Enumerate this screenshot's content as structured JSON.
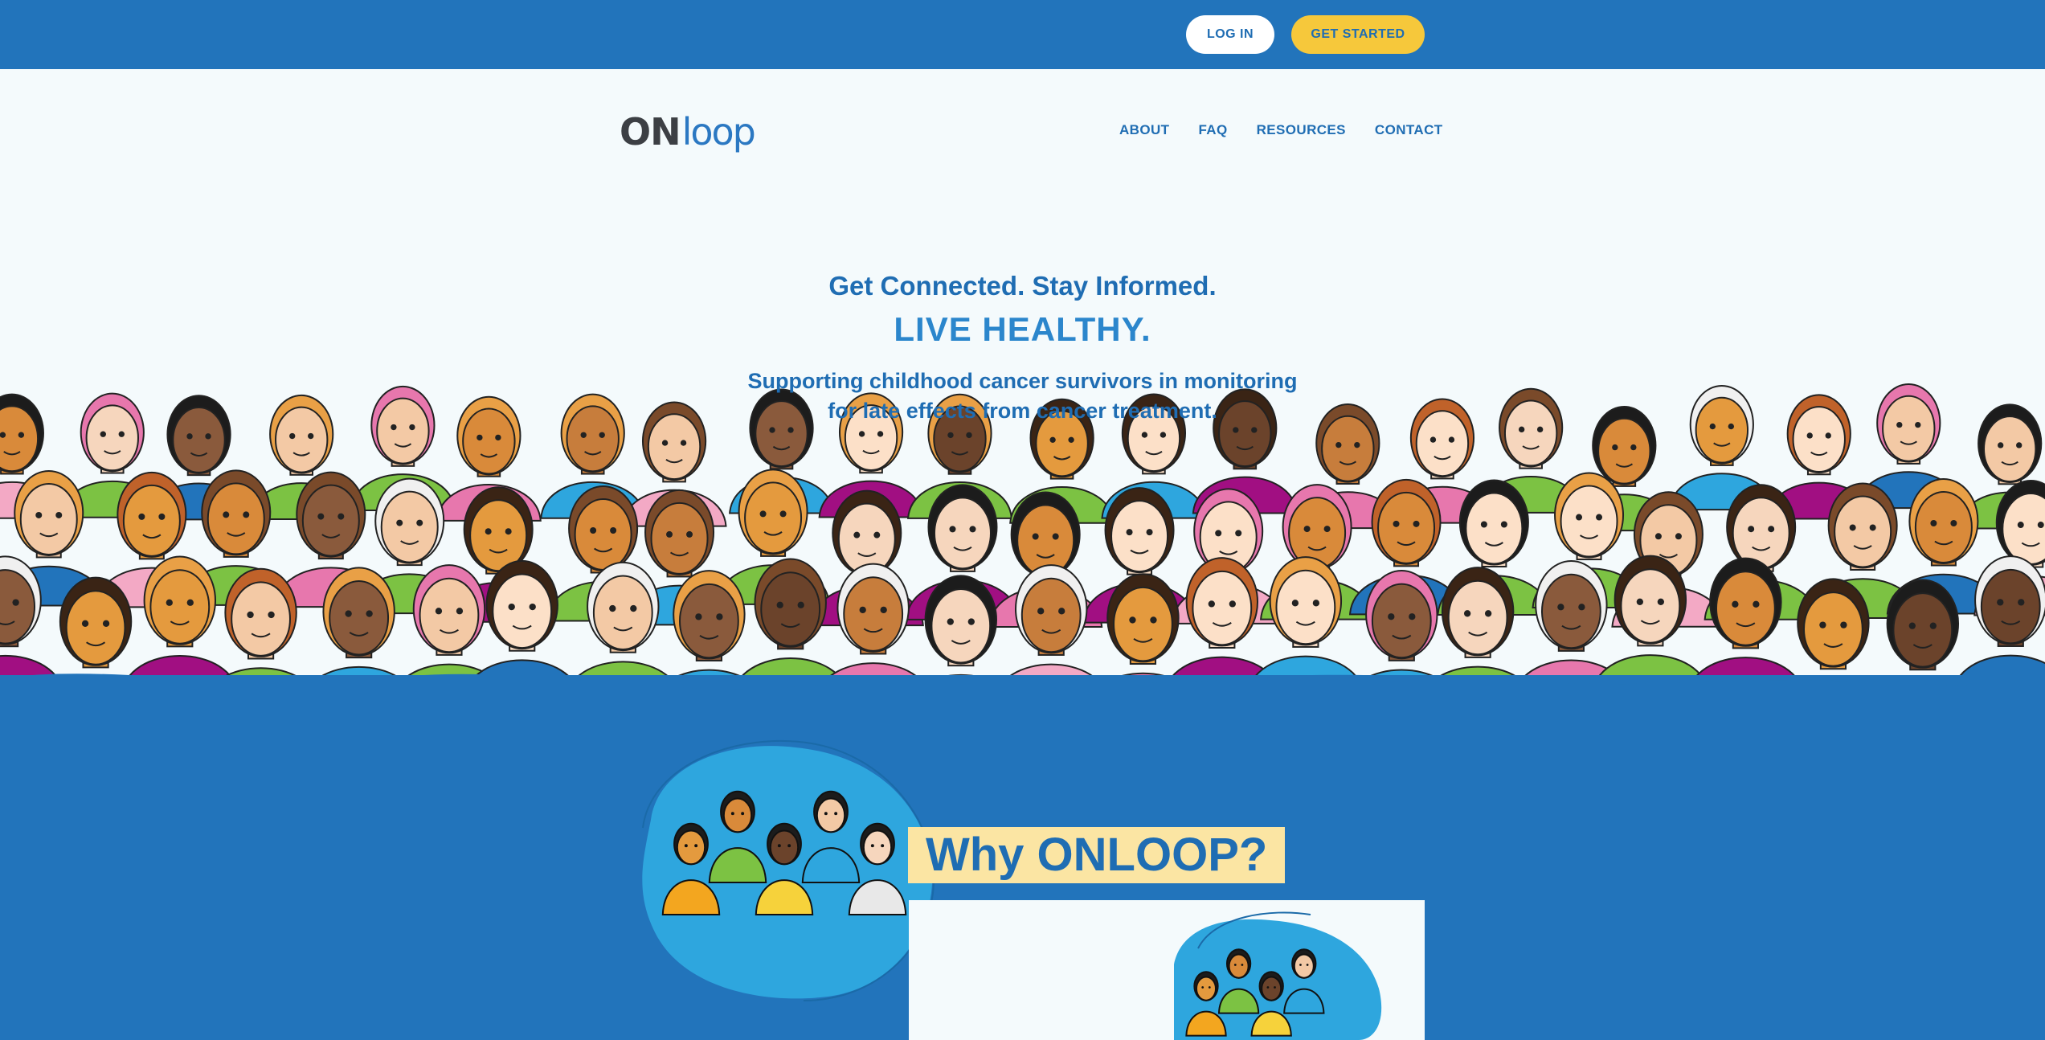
{
  "topbar": {
    "login_label": "LOG IN",
    "get_started_label": "GET STARTED"
  },
  "header": {
    "logo_on": "ON",
    "logo_loop": "loop",
    "nav": [
      {
        "label": "ABOUT"
      },
      {
        "label": "FAQ"
      },
      {
        "label": "RESOURCES"
      },
      {
        "label": "CONTACT"
      }
    ]
  },
  "hero": {
    "tagline": "Get Connected. Stay Informed.",
    "headline": "LIVE HEALTHY.",
    "description": "Supporting childhood cancer survivors in monitoring for late effects from cancer treatment."
  },
  "why": {
    "title": "Why ONLOOP?"
  },
  "colors": {
    "brand_blue": "#2274bb",
    "accent_yellow": "#f6c83b",
    "title_highlight": "#fbe5a3",
    "background": "#f4fafc"
  }
}
